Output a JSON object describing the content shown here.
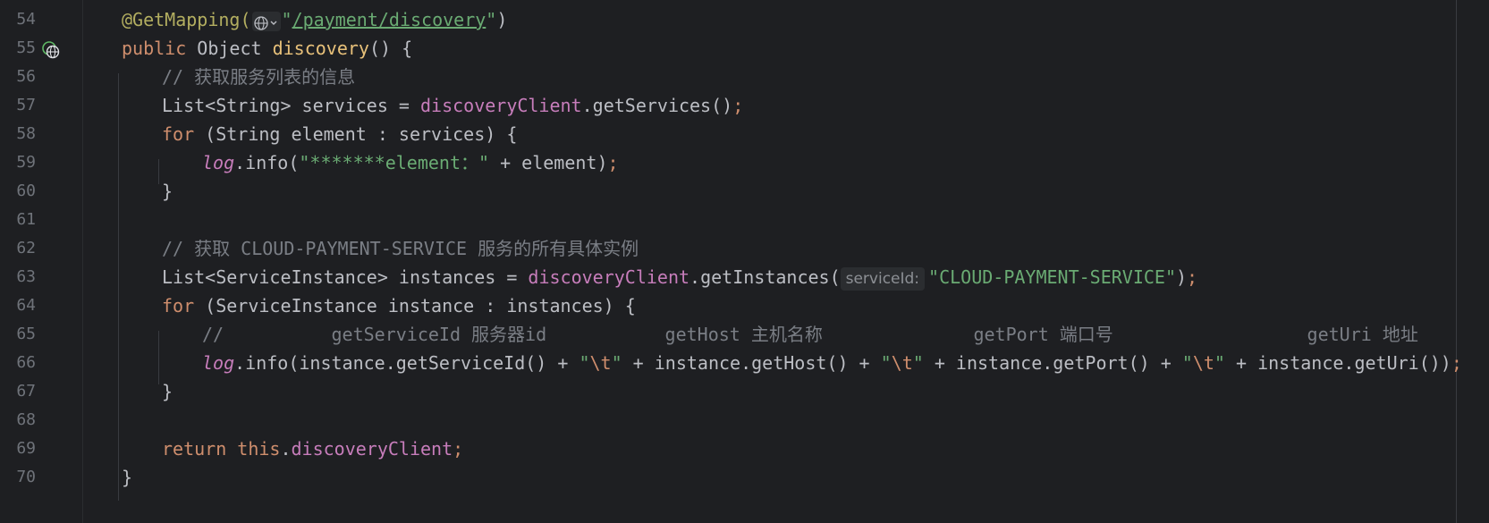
{
  "editor": {
    "line_numbers": [
      "54",
      "55",
      "56",
      "57",
      "58",
      "59",
      "60",
      "61",
      "62",
      "63",
      "64",
      "65",
      "66",
      "67",
      "68",
      "69",
      "70"
    ],
    "lines": {
      "l54": {
        "annotation": "@GetMapping",
        "open": "(",
        "q1": "\"",
        "url": "/payment/discovery",
        "q2": "\"",
        "close": ")"
      },
      "l55": {
        "kw_public": "public",
        "type": " Object ",
        "method": "discovery",
        "rest": "() {"
      },
      "l56": {
        "comment": "// 获取服务列表的信息"
      },
      "l57": {
        "lhs": "List<String> services = ",
        "field": "discoveryClient",
        "call": ".getServices()",
        "semi": ";"
      },
      "l58": {
        "kw_for": "for",
        "rest": " (String element : services) {"
      },
      "l59": {
        "log": "log",
        "call": ".info(",
        "str": "\"*******element：\"",
        "rest": " + element)",
        "semi": ";"
      },
      "l60": {
        "brace": "}"
      },
      "l61": {
        "text": ""
      },
      "l62": {
        "comment": "// 获取 CLOUD-PAYMENT-SERVICE 服务的所有具体实例"
      },
      "l63": {
        "lhs": "List<ServiceInstance> instances = ",
        "field": "discoveryClient",
        "call": ".getInstances(",
        "hint": "serviceId:",
        "str": "\"CLOUD-PAYMENT-SERVICE\"",
        "close": ")",
        "semi": ";"
      },
      "l64": {
        "kw_for": "for",
        "rest": " (ServiceInstance instance : instances) {"
      },
      "l65": {
        "comment": "//          getServiceId 服务器id           getHost 主机名称              getPort 端口号                  getUri 地址"
      },
      "l66": {
        "log": "log",
        "p1": ".info(instance.getServiceId() + ",
        "q1": "\"",
        "e1": "\\t",
        "q1b": "\"",
        "p2": " + instance.getHost() + ",
        "q2": "\"",
        "e2": "\\t",
        "q2b": "\"",
        "p3": " + instance.getPort() + ",
        "q3": "\"",
        "e3": "\\t",
        "q3b": "\"",
        "p4": " + instance.getUri())",
        "semi": ";"
      },
      "l67": {
        "brace": "}"
      },
      "l68": {
        "text": ""
      },
      "l69": {
        "kw_return": "return",
        "kw_this": " this",
        "dot": ".",
        "field": "discoveryClient",
        "semi": ";"
      },
      "l70": {
        "brace": "}"
      }
    },
    "icons": {
      "gutter": "web-endpoint-icon",
      "inline": "globe-icon"
    },
    "colors": {
      "background": "#1e1f22",
      "keyword": "#cf8e6d",
      "annotation": "#b3ae60",
      "method_decl": "#e8c17a",
      "field": "#c77dbb",
      "string": "#6aab73",
      "comment": "#7a7e85",
      "text": "#bcbec4",
      "line_number": "#6f737a"
    }
  }
}
